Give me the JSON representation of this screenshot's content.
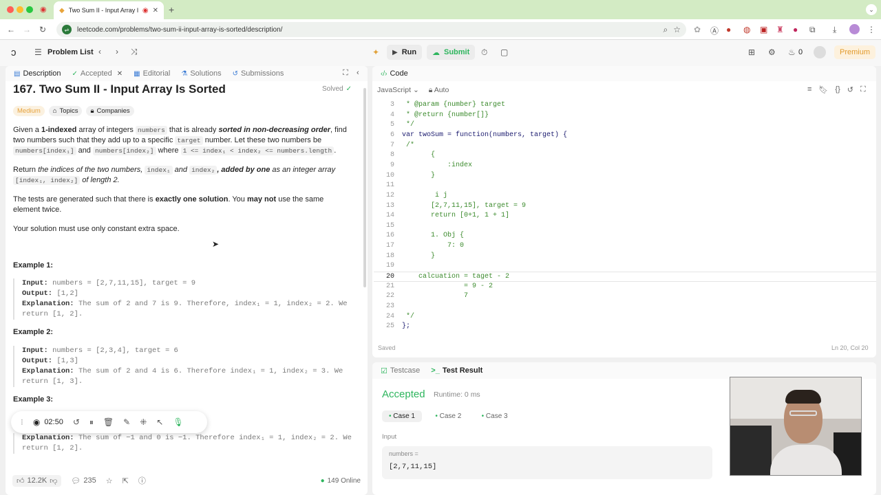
{
  "browser": {
    "tab_title": "Two Sum II - Input Array I",
    "url": "leetcode.com/problems/two-sum-ii-input-array-is-sorted/description/",
    "accent": "#d3ebc4"
  },
  "topbar": {
    "problem_list": "Problem List",
    "run": "Run",
    "submit": "Submit",
    "streak": "0",
    "premium": "Premium"
  },
  "left_tabs": [
    "Description",
    "Accepted",
    "Editorial",
    "Solutions",
    "Submissions"
  ],
  "problem": {
    "title": "167. Two Sum II - Input Array Is Sorted",
    "solved": "Solved",
    "difficulty": "Medium",
    "topics": "Topics",
    "companies": "Companies",
    "p1": {
      "a": "Given a ",
      "b": "1-indexed",
      "c": " array of integers ",
      "d": "numbers",
      "e": " that is already ",
      "f": "sorted in non-decreasing order",
      "g": ", find two numbers such that they add up to a specific ",
      "h": "target",
      "i": " number. Let these two numbers be ",
      "j": "numbers[index₁]",
      "k": " and ",
      "l": "numbers[index₂]",
      "m": " where ",
      "n": "1 <= index₁ < index₂ <= numbers.length",
      "o": "."
    },
    "p2": {
      "a": "Return ",
      "b": "the indices of the two numbers,",
      "c": "index₁",
      "d": "and",
      "e": "index₂",
      "f": ", added by one",
      "g": " as an integer array ",
      "h": "[index₁, index₂]",
      "i": " of length 2."
    },
    "p3": {
      "a": "The tests are generated such that there is ",
      "b": "exactly one solution",
      "c": ". You ",
      "d": "may not",
      "e": " use the same element twice."
    },
    "p4": "Your solution must use only constant extra space.",
    "examples": [
      {
        "title": "Example 1:",
        "input_label": "Input:",
        "input": "numbers = [2,7,11,15], target = 9",
        "output_label": "Output:",
        "output": "[1,2]",
        "expl_label": "Explanation:",
        "expl": "The sum of 2 and 7 is 9. Therefore, index₁ = 1, index₂ = 2. We return [1, 2]."
      },
      {
        "title": "Example 2:",
        "input_label": "Input:",
        "input": "numbers = [2,3,4], target = 6",
        "output_label": "Output:",
        "output": "[1,3]",
        "expl_label": "Explanation:",
        "expl": "The sum of 2 and 4 is 6. Therefore index₁ = 1, index₂ = 3. We return [1, 3]."
      },
      {
        "title": "Example 3:",
        "expl_label": "Explanation:",
        "expl": "The sum of −1 and 0 is −1. Therefore index₁ = 1, index₂ = 2. We return [1, 2]."
      }
    ]
  },
  "recorder": {
    "time": "02:50"
  },
  "footer": {
    "likes": "12.2K",
    "comments": "235",
    "online": "149 Online"
  },
  "editor": {
    "header": "Code",
    "language": "JavaScript",
    "mode": "Auto",
    "saved": "Saved",
    "cursor": "Ln 20, Col 20",
    "lines": [
      {
        "n": "3",
        "t": " * @param {number} target"
      },
      {
        "n": "4",
        "t": " * @return {number[]}"
      },
      {
        "n": "5",
        "t": " */"
      },
      {
        "n": "6",
        "t": "var twoSum = function(numbers, target) {"
      },
      {
        "n": "7",
        "t": " /*"
      },
      {
        "n": "8",
        "t": "       {"
      },
      {
        "n": "9",
        "t": "           :index"
      },
      {
        "n": "10",
        "t": "       }"
      },
      {
        "n": "11",
        "t": ""
      },
      {
        "n": "12",
        "t": "        i j"
      },
      {
        "n": "13",
        "t": "       [2,7,11,15], target = 9"
      },
      {
        "n": "14",
        "t": "       return [0+1, 1 + 1]"
      },
      {
        "n": "15",
        "t": ""
      },
      {
        "n": "16",
        "t": "       1. Obj {"
      },
      {
        "n": "17",
        "t": "           7: 0"
      },
      {
        "n": "18",
        "t": "       }"
      },
      {
        "n": "19",
        "t": ""
      },
      {
        "n": "20",
        "t": "    calcuation = taget - 2"
      },
      {
        "n": "21",
        "t": "               = 9 - 2"
      },
      {
        "n": "22",
        "t": "               7"
      },
      {
        "n": "23",
        "t": ""
      },
      {
        "n": "24",
        "t": " */"
      },
      {
        "n": "25",
        "t": "};"
      }
    ]
  },
  "results": {
    "tab1": "Testcase",
    "tab2": "Test Result",
    "status": "Accepted",
    "runtime": "Runtime: 0 ms",
    "cases": [
      "Case 1",
      "Case 2",
      "Case 3"
    ],
    "input_label": "Input",
    "var_label": "numbers =",
    "var_value": "[2,7,11,15]",
    "accent": "#2db55d"
  }
}
